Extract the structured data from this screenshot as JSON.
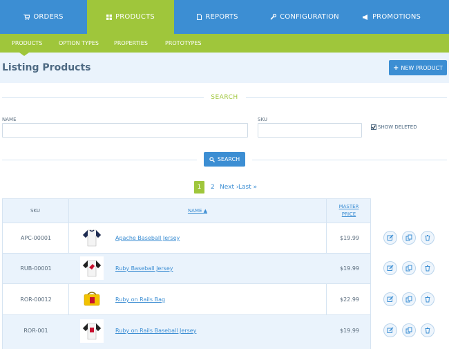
{
  "nav": {
    "tabs": [
      {
        "label": "ORDERS",
        "icon": "cart-icon",
        "active": false
      },
      {
        "label": "PRODUCTS",
        "icon": "grid-icon",
        "active": true
      },
      {
        "label": "REPORTS",
        "icon": "file-icon",
        "active": false
      },
      {
        "label": "CONFIGURATION",
        "icon": "wrench-icon",
        "active": false
      },
      {
        "label": "PROMOTIONS",
        "icon": "bullhorn-icon",
        "active": false
      }
    ],
    "subtabs": [
      "PRODUCTS",
      "OPTION TYPES",
      "PROPERTIES",
      "PROTOTYPES"
    ]
  },
  "header": {
    "title": "Listing Products",
    "new_button": "NEW PRODUCT"
  },
  "search": {
    "legend": "SEARCH",
    "name_label": "NAME",
    "name_value": "",
    "sku_label": "SKU",
    "sku_value": "",
    "show_deleted_label": "SHOW DELETED",
    "show_deleted_checked": true,
    "button": "SEARCH"
  },
  "pagination": {
    "current": "1",
    "page2": "2",
    "next": "Next ›",
    "last": "Last »"
  },
  "table": {
    "headers": {
      "sku": "SKU",
      "name": "NAME ▲",
      "price_line1": "MASTER",
      "price_line2": "PRICE"
    },
    "rows": [
      {
        "sku": "APC-00001",
        "name": "Apache Baseball Jersey",
        "price": "$19.99",
        "thumb": "jersey-navy"
      },
      {
        "sku": "RUB-00001",
        "name": "Ruby Baseball Jersey",
        "price": "$19.99",
        "thumb": "jersey-red"
      },
      {
        "sku": "ROR-00012",
        "name": "Ruby on Rails Bag",
        "price": "$22.99",
        "thumb": "bag-yellow"
      },
      {
        "sku": "ROR-001",
        "name": "Ruby on Rails Baseball Jersey",
        "price": "$19.99",
        "thumb": "jersey-black"
      }
    ]
  },
  "colors": {
    "primary": "#3c8ed3",
    "accent": "#9fc63b",
    "light": "#eaf3fc"
  }
}
